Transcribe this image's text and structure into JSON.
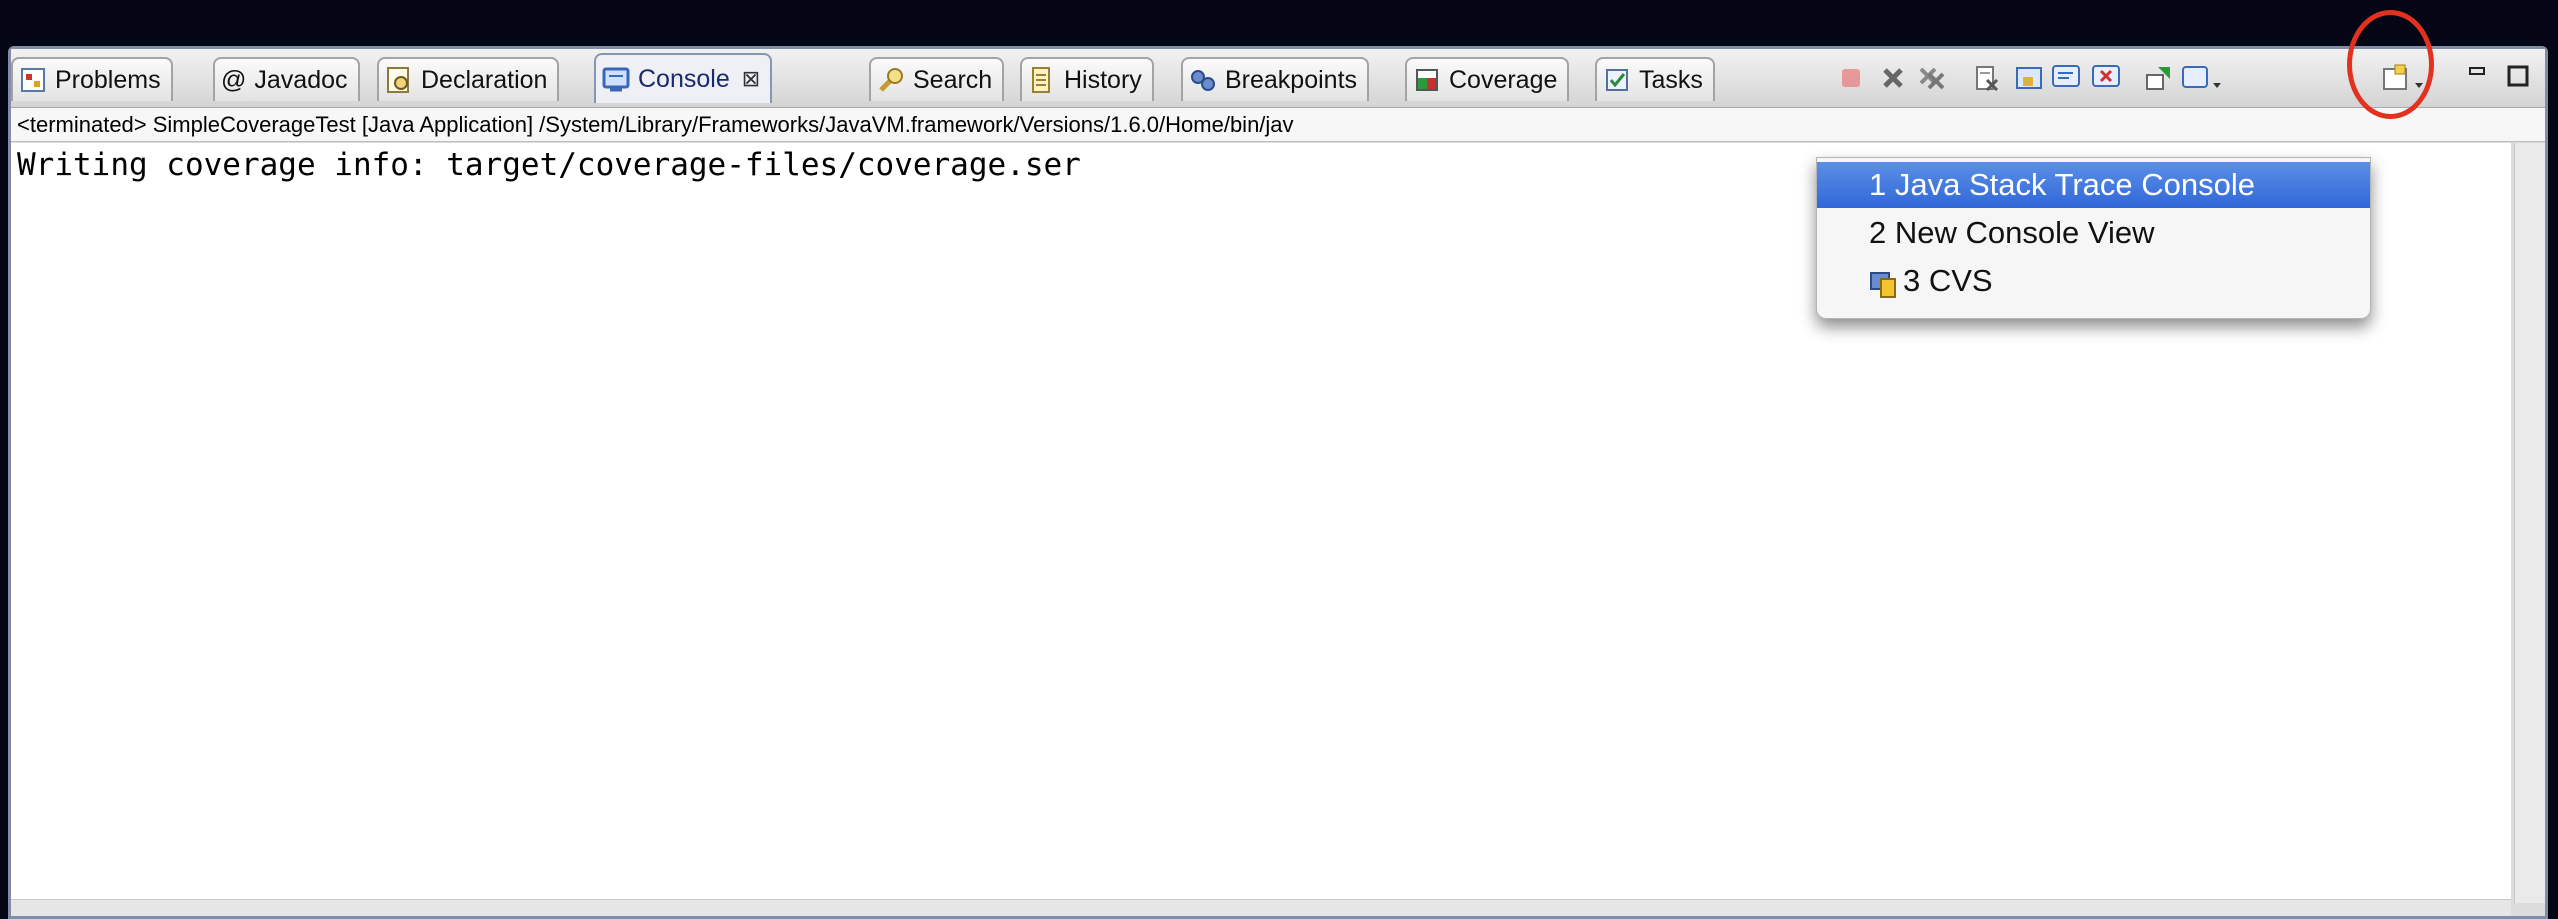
{
  "tabs": [
    {
      "label": "Problems",
      "icon": "problems-icon"
    },
    {
      "label": "@",
      "icon": "at-sign"
    },
    {
      "label": "Javadoc",
      "icon": "javadoc-icon"
    },
    {
      "label": "Declaration",
      "icon": "declaration-icon"
    },
    {
      "label": "Console",
      "icon": "console-icon",
      "close": "⊠"
    },
    {
      "label": "Search",
      "icon": "search-icon"
    },
    {
      "label": "History",
      "icon": "history-icon"
    },
    {
      "label": "Breakpoints",
      "icon": "breakpoints-icon"
    },
    {
      "label": "Coverage",
      "icon": "coverage-icon"
    },
    {
      "label": "Tasks",
      "icon": "tasks-icon"
    }
  ],
  "infobar": {
    "text": "<terminated> SimpleCoverageTest [Java Application] /System/Library/Frameworks/JavaVM.framework/Versions/1.6.0/Home/bin/jav"
  },
  "console": {
    "output": "Writing coverage info: target/coverage-files/coverage.ser"
  },
  "menu": {
    "items": [
      {
        "label": "1 Java Stack Trace Console",
        "selected": true
      },
      {
        "label": "2 New Console View"
      },
      {
        "label": "3 CVS",
        "icon": "cvs-icon"
      }
    ]
  },
  "toolbar": {
    "icons": [
      "terminate-icon",
      "remove-launch-icon",
      "remove-all-terminated-icon",
      "clear-console-icon",
      "scroll-lock-icon",
      "show-on-stdout-icon",
      "show-on-stderr-icon",
      "pin-console-icon",
      "display-selected-console-icon",
      "open-console-icon",
      "minimize-icon",
      "maximize-icon"
    ]
  },
  "colors": {
    "highlight": "#3d73dc",
    "annotation": "#e2321f"
  }
}
